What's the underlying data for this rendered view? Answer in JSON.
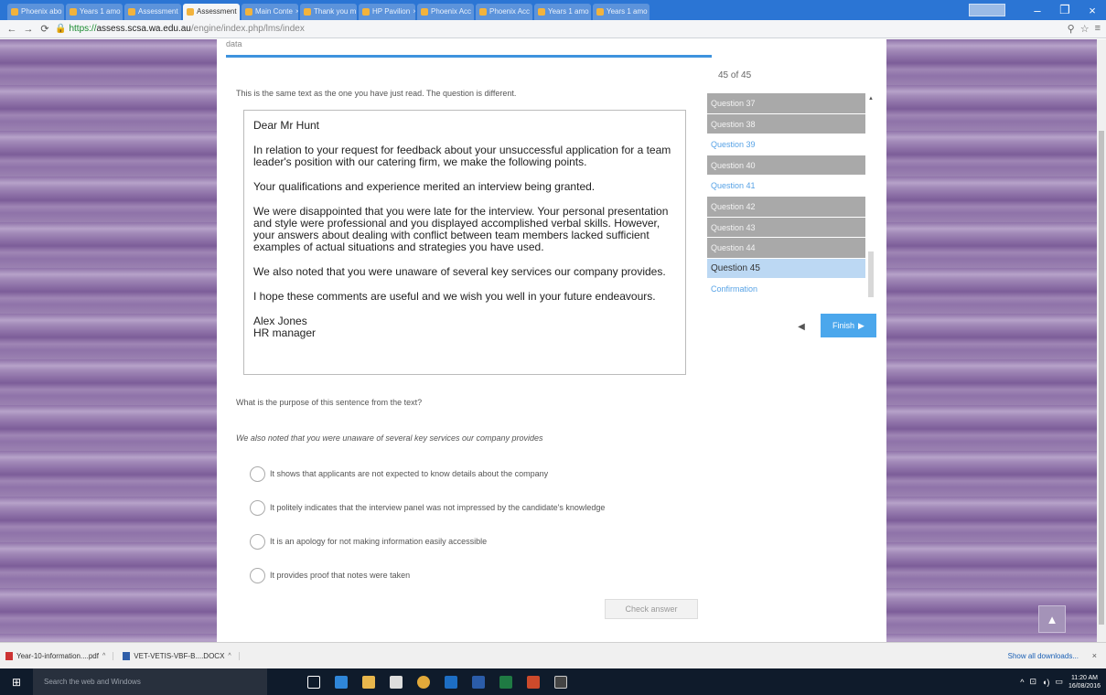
{
  "browser": {
    "tabs": [
      {
        "label": "Phoenix abo",
        "active": false
      },
      {
        "label": "Years 1 amo",
        "active": false
      },
      {
        "label": "Assessment",
        "active": false
      },
      {
        "label": "Assessment",
        "active": true
      },
      {
        "label": "Main Conte",
        "active": false
      },
      {
        "label": "Thank you m",
        "active": false
      },
      {
        "label": "HP Pavilion",
        "active": false
      },
      {
        "label": "Phoenix Acc",
        "active": false
      },
      {
        "label": "Phoenix Acc",
        "active": false
      },
      {
        "label": "Years 1 amo",
        "active": false
      },
      {
        "label": "Years 1 amo",
        "active": false
      }
    ],
    "url": {
      "scheme": "https://",
      "host": "assess.scsa.wa.edu.au",
      "path": "/engine/index.php/lms/index"
    },
    "window_controls": {
      "minimize": "–",
      "restore": "❐",
      "close": "×"
    }
  },
  "assessment": {
    "progress_label": "data",
    "progress_fraction": 1.0,
    "intro": "This is the same text as the one you have just read. The question is different.",
    "passage": {
      "salutation": "Dear Mr Hunt",
      "paragraphs": [
        "In relation to your request for feedback about your unsuccessful application for a team leader's position with our catering firm, we make the following points.",
        "Your qualifications and experience merited an interview being granted.",
        "We were disappointed that you were late for the interview. Your personal presentation and style were professional and you displayed accomplished verbal skills. However, your answers about dealing with conflict between team members lacked sufficient examples of actual situations and strategies you have used.",
        "We also noted that you were unaware of several key services our company provides.",
        "I hope these comments are useful and we wish you well in your future endeavours."
      ],
      "signature_name": "Alex Jones",
      "signature_title": "HR manager"
    },
    "question": "What is the purpose of this sentence from the text?",
    "quoted_sentence": "We also noted that you were unaware of several key services our company provides",
    "options": [
      "It shows that applicants are not expected to know details about the company",
      "It politely indicates that the interview panel was not impressed by the candidate's knowledge",
      "It is an apology for not making information easily accessible",
      "It provides proof that notes were taken"
    ],
    "check_answer_label": "Check answer"
  },
  "sidebar": {
    "counter": "45 of 45",
    "questions": [
      {
        "label": "Question 37",
        "state": "answered"
      },
      {
        "label": "Question 38",
        "state": "answered"
      },
      {
        "label": "Question 39",
        "state": "unanswered"
      },
      {
        "label": "Question 40",
        "state": "answered"
      },
      {
        "label": "Question 41",
        "state": "unanswered"
      },
      {
        "label": "Question 42",
        "state": "answered"
      },
      {
        "label": "Question 43",
        "state": "answered"
      },
      {
        "label": "Question 44",
        "state": "answered"
      },
      {
        "label": "Question 45",
        "state": "current"
      },
      {
        "label": "Confirmation",
        "state": "unanswered"
      }
    ],
    "prev_icon": "◀",
    "finish_label": "Finish"
  },
  "downloads": {
    "items": [
      {
        "name": "Year-10-information....pdf",
        "type": "pdf"
      },
      {
        "name": "VET-VETIS-VBF-B....DOCX",
        "type": "docx"
      }
    ],
    "show_all": "Show all downloads..."
  },
  "taskbar": {
    "search_placeholder": "Search the web and Windows",
    "time": "11:20 AM",
    "date": "16/08/2016"
  },
  "colors": {
    "accent": "#4ba7ec",
    "answered": "#a9a9a9",
    "current": "#bcd8f3",
    "page_bg": "#8f73a9"
  }
}
